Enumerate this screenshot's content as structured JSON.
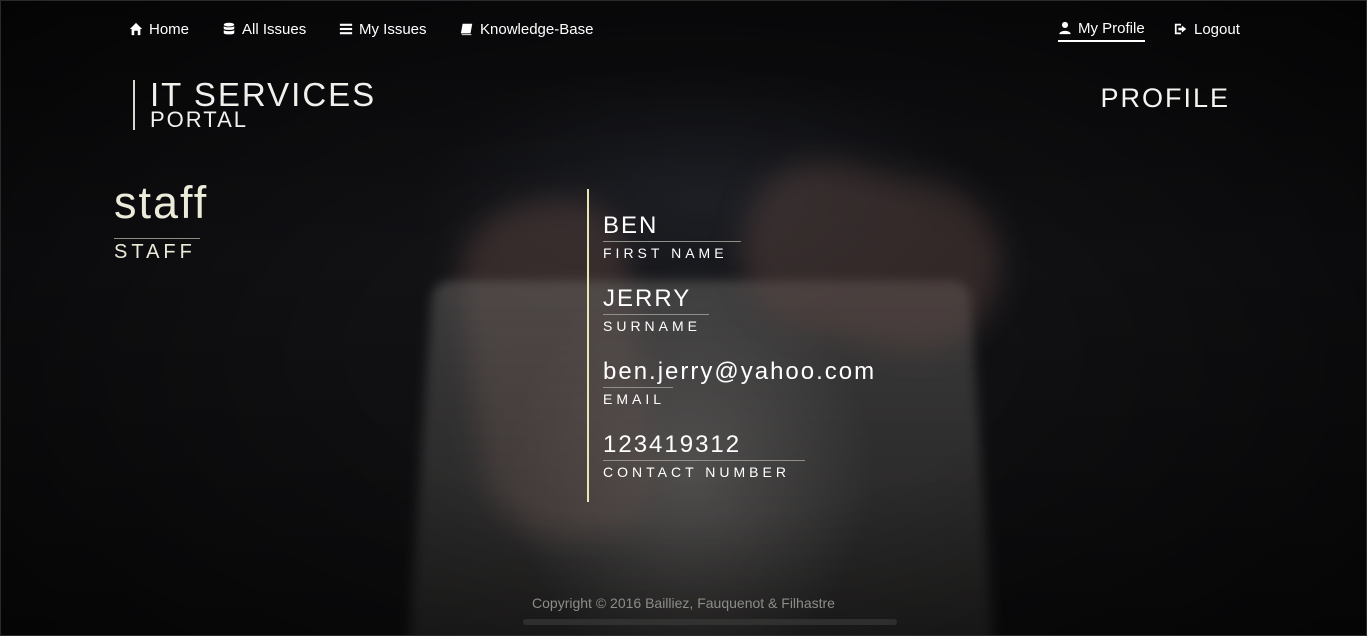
{
  "nav": {
    "home": "Home",
    "all_issues": "All Issues",
    "my_issues": "My Issues",
    "knowledge_base": "Knowledge-Base",
    "my_profile": "My Profile",
    "logout": "Logout"
  },
  "brand": {
    "title": "IT SERVICES",
    "subtitle": "PORTAL"
  },
  "page_title": "PROFILE",
  "profile": {
    "username": "staff",
    "role": "STAFF",
    "fields": [
      {
        "value": "BEN",
        "label": "FIRST NAME"
      },
      {
        "value": "JERRY",
        "label": "SURNAME"
      },
      {
        "value": "ben.jerry@yahoo.com",
        "label": "EMAIL"
      },
      {
        "value": "123419312",
        "label": "CONTACT NUMBER"
      }
    ]
  },
  "footer": "Copyright © 2016 Bailliez, Fauquenot & Filhastre",
  "colors": {
    "accent_line": "#e9e5b8",
    "username": "#ecead8"
  }
}
